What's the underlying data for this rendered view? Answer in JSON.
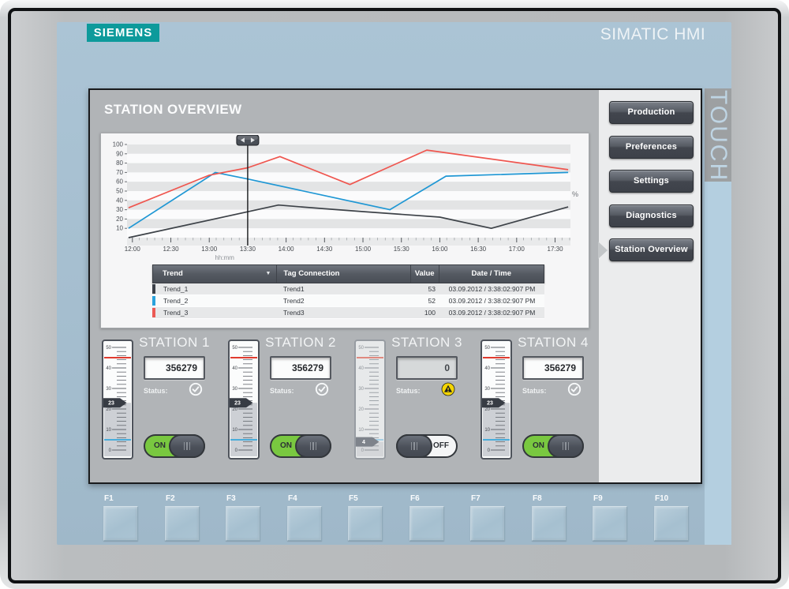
{
  "brand": {
    "logo": "SIEMENS",
    "product": "SIMATIC HMI",
    "touch": "TOUCH",
    "teal": "#0d9a9b"
  },
  "screen": {
    "title": "STATION OVERVIEW",
    "nav": [
      {
        "label": "Production",
        "active": false
      },
      {
        "label": "Preferences",
        "active": false
      },
      {
        "label": "Settings",
        "active": false
      },
      {
        "label": "Diagnostics",
        "active": false
      },
      {
        "label": "Station Overview",
        "active": true
      }
    ],
    "table": {
      "columns": [
        "Trend",
        "Tag Connection",
        "Value",
        "Date / Time"
      ],
      "rows": [
        {
          "trend": "Trend_1",
          "tag": "Trend1",
          "value": "53",
          "datetime": "03.09.2012 / 3:38:02:907 PM",
          "color": "#3b4048"
        },
        {
          "trend": "Trend_2",
          "tag": "Trend2",
          "value": "52",
          "datetime": "03.09.2012 / 3:38:02:907 PM",
          "color": "#2aa2dc"
        },
        {
          "trend": "Trend_3",
          "tag": "Trend3",
          "value": "100",
          "datetime": "03.09.2012 / 3:38:02:907 PM",
          "color": "#eb5a55"
        }
      ]
    },
    "stations": [
      {
        "title": "STATION 1",
        "display": "356279",
        "status_label": "Status:",
        "status": "ok",
        "slider": {
          "min": 0,
          "max": 50,
          "value": 23,
          "high_limit": 45,
          "low_limit": 5,
          "disabled": false
        },
        "toggle": {
          "on": true,
          "label": "ON"
        }
      },
      {
        "title": "STATION 2",
        "display": "356279",
        "status_label": "Status:",
        "status": "ok",
        "slider": {
          "min": 0,
          "max": 50,
          "value": 23,
          "high_limit": 45,
          "low_limit": 5,
          "disabled": false
        },
        "toggle": {
          "on": true,
          "label": "ON"
        }
      },
      {
        "title": "STATION 3",
        "display": "0",
        "status_label": "Status:",
        "status": "warning",
        "slider": {
          "min": 0,
          "max": 50,
          "value": 4,
          "high_limit": 45,
          "low_limit": 5,
          "disabled": true
        },
        "toggle": {
          "on": false,
          "label": "OFF"
        }
      },
      {
        "title": "STATION 4",
        "display": "356279",
        "status_label": "Status:",
        "status": "ok",
        "slider": {
          "min": 0,
          "max": 50,
          "value": 23,
          "high_limit": 45,
          "low_limit": 5,
          "disabled": false
        },
        "toggle": {
          "on": true,
          "label": "ON"
        }
      }
    ]
  },
  "chart_data": {
    "type": "line",
    "title": "",
    "xlabel": "hh:mm",
    "ylabel": "%",
    "ylim": [
      0,
      100
    ],
    "y_ticks": [
      10,
      20,
      30,
      40,
      50,
      60,
      70,
      80,
      90,
      100
    ],
    "x_ticks": [
      "12:00",
      "12:30",
      "13:00",
      "13:30",
      "14:00",
      "14:30",
      "15:00",
      "15:30",
      "16:00",
      "16:30",
      "17:00",
      "17:30"
    ],
    "x_range_hours": [
      11.93,
      17.7
    ],
    "cursor_hours": 13.5,
    "grid": "horizontal-alternating-bands",
    "legend_position": "none",
    "series": [
      {
        "name": "Trend_1",
        "color": "#3d4248",
        "points": [
          [
            11.95,
            0
          ],
          [
            13.9,
            35
          ],
          [
            14.5,
            31
          ],
          [
            15.0,
            28
          ],
          [
            16.0,
            22
          ],
          [
            16.67,
            10
          ],
          [
            17.67,
            33
          ]
        ]
      },
      {
        "name": "Trend_2",
        "color": "#1f97d4",
        "points": [
          [
            11.95,
            10
          ],
          [
            13.08,
            70
          ],
          [
            13.5,
            63
          ],
          [
            15.35,
            30
          ],
          [
            16.08,
            66
          ],
          [
            17.67,
            70
          ]
        ]
      },
      {
        "name": "Trend_3",
        "color": "#ef564f",
        "points": [
          [
            11.95,
            32
          ],
          [
            13.0,
            67
          ],
          [
            13.5,
            75
          ],
          [
            13.92,
            87
          ],
          [
            14.83,
            57
          ],
          [
            15.83,
            94
          ],
          [
            17.67,
            73
          ]
        ]
      }
    ]
  },
  "function_keys": [
    "F1",
    "F2",
    "F3",
    "F4",
    "F5",
    "F6",
    "F7",
    "F8",
    "F9",
    "F10"
  ]
}
